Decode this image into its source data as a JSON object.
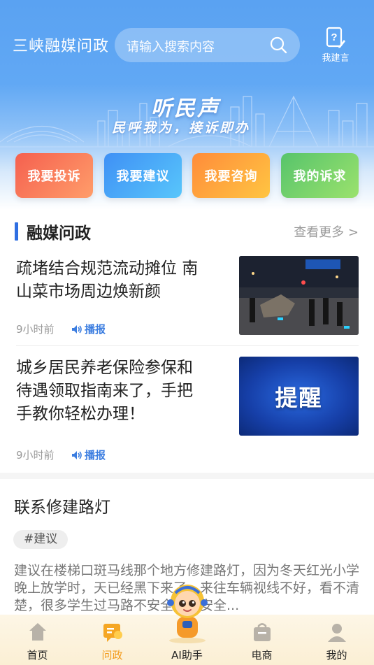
{
  "header": {
    "app_title": "三峡融媒问政",
    "search_placeholder": "请输入搜索内容",
    "suggest_label": "我建言",
    "slogan_main": "听民声",
    "slogan_sub": "民呼我为，接诉即办"
  },
  "actions": [
    {
      "label": "我要投诉",
      "color_from": "#f5604f",
      "color_to": "#ff9d6a"
    },
    {
      "label": "我要建议",
      "color_from": "#3f90f5",
      "color_to": "#58c6fb"
    },
    {
      "label": "我要咨询",
      "color_from": "#ff8c3a",
      "color_to": "#ffc542"
    },
    {
      "label": "我的诉求",
      "color_from": "#57c46b",
      "color_to": "#9be26d"
    }
  ],
  "section": {
    "title": "融媒问政",
    "more": "查看更多 >"
  },
  "news": [
    {
      "title_line1": "疏堵结合规范流动摊位 南",
      "title_line2": "山菜市场周边焕新颜",
      "time": "9小时前",
      "play": "播报"
    },
    {
      "title_line1": "城乡居民养老保险参保和",
      "title_line2": "待遇领取指南来了，手把",
      "title_line3": "手教你轻松办理！",
      "time": "9小时前",
      "play": "播报",
      "image_text": "提醒"
    }
  ],
  "card": {
    "title": "联系修建路灯",
    "tag": "#建议",
    "body": "建议在楼梯口斑马线那个地方修建路灯，因为冬天红光小学晚上放学时，天已经黑下来了，来往车辆视线不好，看不清楚，很多学生过马路不安全，有安全..."
  },
  "tabbar": {
    "items": [
      {
        "label": "首页",
        "icon": "home-icon"
      },
      {
        "label": "问政",
        "icon": "wenzheng-icon"
      },
      {
        "label": "AI助手",
        "icon": "ai-assistant-icon"
      },
      {
        "label": "电商",
        "icon": "shop-bag-icon"
      },
      {
        "label": "我的",
        "icon": "user-icon"
      }
    ],
    "active_color": "#f39a1a"
  }
}
